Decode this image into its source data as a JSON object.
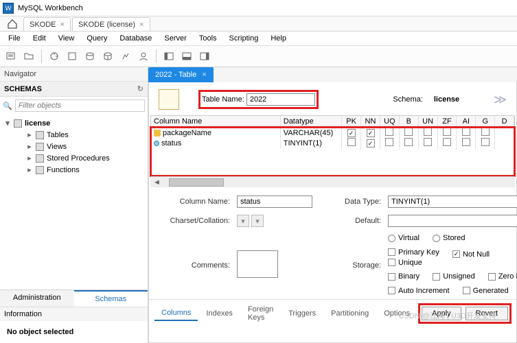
{
  "app": {
    "title": "MySQL Workbench"
  },
  "conn_tabs": [
    {
      "label": "SKODE"
    },
    {
      "label": "SKODE (license)"
    }
  ],
  "menu": [
    "File",
    "Edit",
    "View",
    "Query",
    "Database",
    "Server",
    "Tools",
    "Scripting",
    "Help"
  ],
  "navigator": {
    "title": "Navigator",
    "schemas_header": "SCHEMAS",
    "filter_placeholder": "Filter objects"
  },
  "tree": {
    "db": "license",
    "children": [
      "Tables",
      "Views",
      "Stored Procedures",
      "Functions"
    ]
  },
  "side_tabs": {
    "admin": "Administration",
    "schemas": "Schemas"
  },
  "info": {
    "header": "Information",
    "body": "No object selected"
  },
  "editor_tab": "2022 - Table",
  "header_form": {
    "table_name_label": "Table Name:",
    "table_name_value": "2022",
    "schema_label": "Schema:",
    "schema_value": "license"
  },
  "columns": {
    "headers": [
      "Column Name",
      "Datatype",
      "PK",
      "NN",
      "UQ",
      "B",
      "UN",
      "ZF",
      "AI",
      "G",
      "D"
    ],
    "rows": [
      {
        "icon": "key",
        "name": "packageName",
        "type": "VARCHAR(45)",
        "pk": true,
        "nn": true,
        "uq": false,
        "b": false,
        "un": false,
        "zf": false,
        "ai": false,
        "g": false
      },
      {
        "icon": "dot",
        "name": "status",
        "type": "TINYINT(1)",
        "pk": false,
        "nn": true,
        "uq": false,
        "b": false,
        "un": false,
        "zf": false,
        "ai": false,
        "g": false
      }
    ]
  },
  "detail": {
    "column_name_label": "Column Name:",
    "column_name_value": "status",
    "datatype_label": "Data Type:",
    "datatype_value": "TINYINT(1)",
    "charset_label": "Charset/Collation:",
    "default_label": "Default:",
    "default_value": "",
    "comments_label": "Comments:",
    "storage_label": "Storage:",
    "virtual": "Virtual",
    "stored": "Stored",
    "primary_key": "Primary Key",
    "not_null": "Not Null",
    "unique": "Unique",
    "binary": "Binary",
    "unsigned": "Unsigned",
    "zero_fill": "Zero Fill",
    "auto_inc": "Auto Increment",
    "generated": "Generated",
    "flags": {
      "not_null": true
    }
  },
  "bottom_tabs": [
    "Columns",
    "Indexes",
    "Foreign Keys",
    "Triggers",
    "Partitioning",
    "Options"
  ],
  "buttons": {
    "apply": "Apply",
    "revert": "Revert"
  },
  "watermark": "CSDN @江河 | U3D开发支持"
}
